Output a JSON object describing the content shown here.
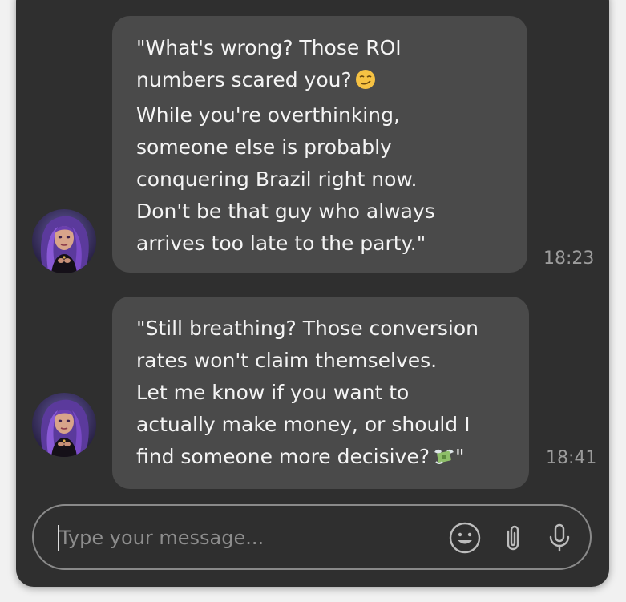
{
  "messages": [
    {
      "text": "\"What's wrong? Those ROI\nnumbers scared you?",
      "text_rest": "\nWhile you're overthinking,\nsomeone else is probably\nconquering Brazil right now.\nDon't be that guy who always\narrives too late to the party.\"",
      "emoji": "smirk",
      "time": "18:23"
    },
    {
      "text": "\"Still breathing? Those conversion\nrates won't claim themselves.\nLet me know if you want to\nactually make money, or should I\nfind someone more decisive?",
      "text_rest": "\"",
      "emoji": "money-with-wings",
      "time": "18:41"
    }
  ],
  "composer": {
    "placeholder": "Type your message...",
    "value": ""
  },
  "colors": {
    "panel_bg": "#2f2f2f",
    "bubble_bg": "#4a4a4a",
    "text": "#f4f4f4",
    "timestamp": "#9c9c9c",
    "border": "#8a8a8a",
    "page_bg": "#f1f1f1"
  },
  "icons": [
    "emoji-icon",
    "paperclip-icon",
    "microphone-icon",
    "avatar"
  ]
}
